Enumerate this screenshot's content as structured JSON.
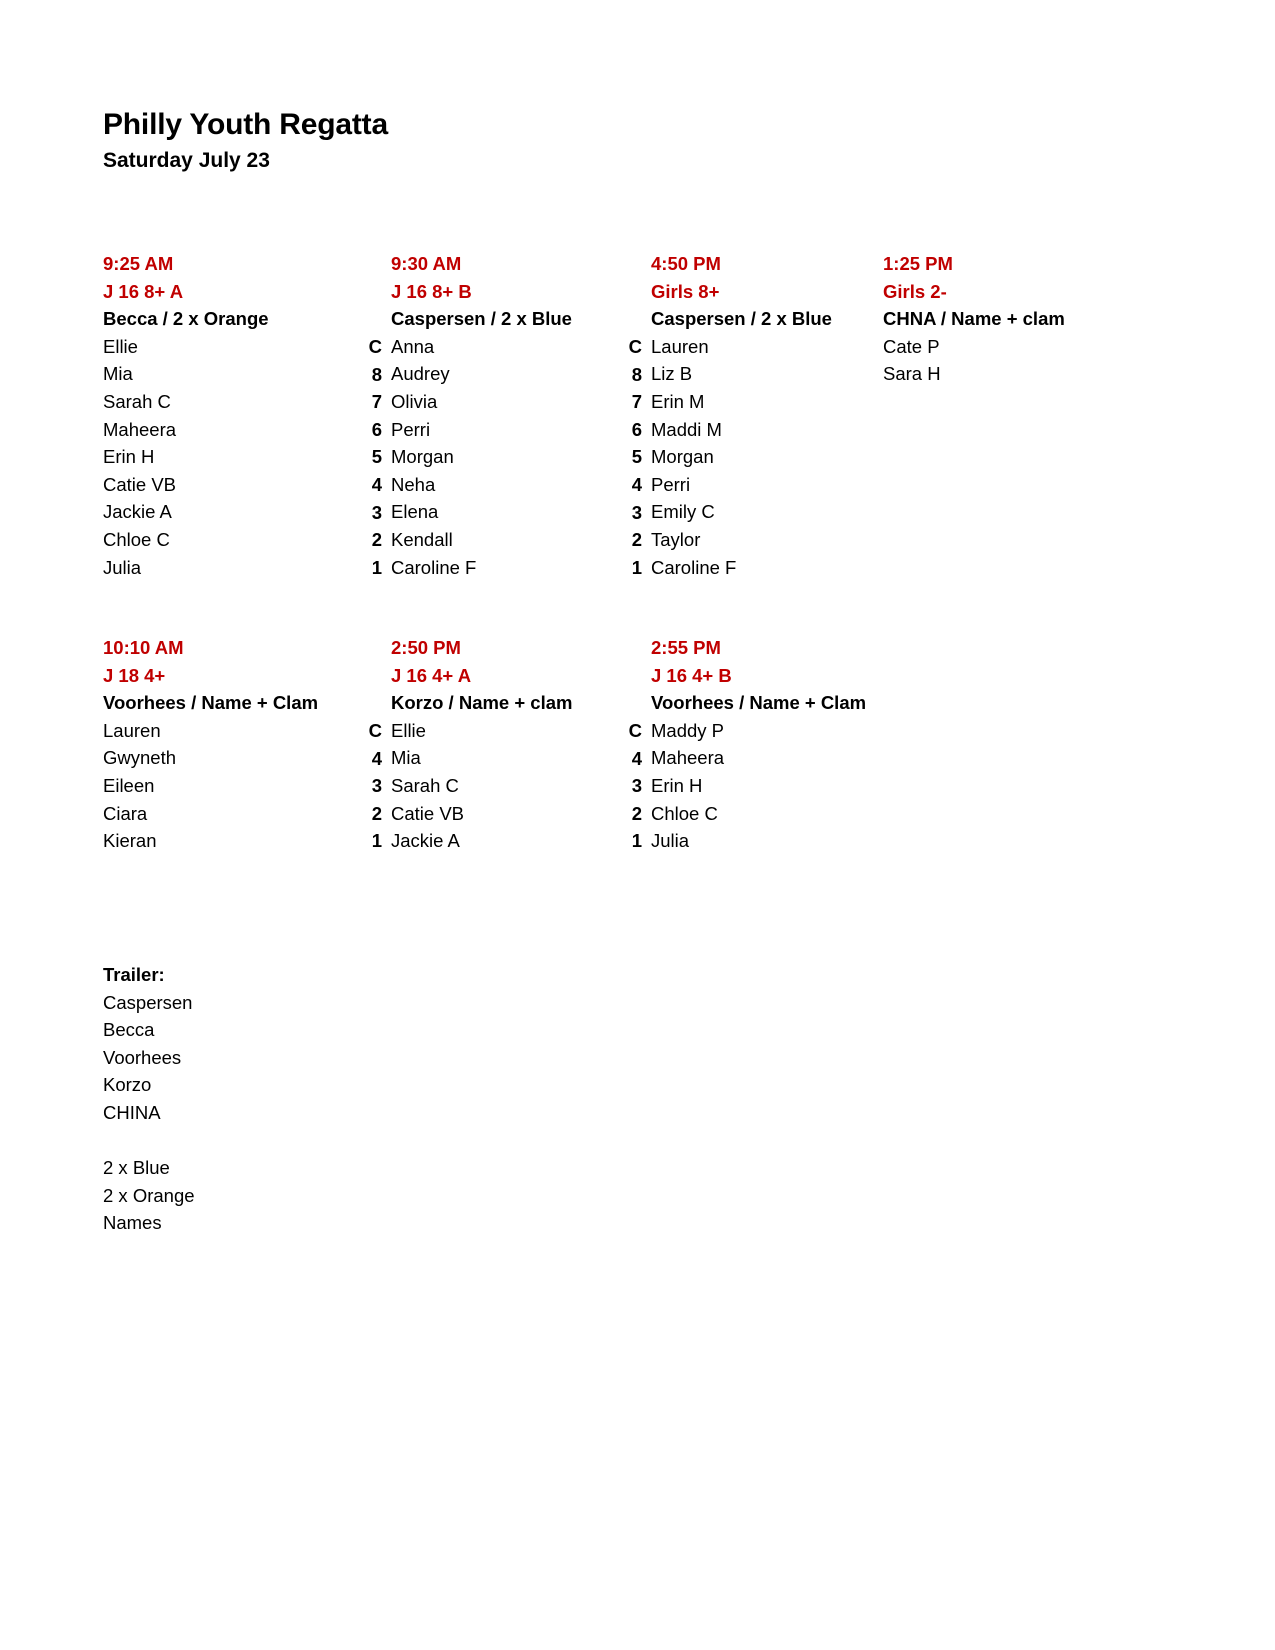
{
  "header": {
    "title": "Philly Youth Regatta",
    "subtitle": "Saturday July 23"
  },
  "colors": {
    "heading_red": "#C00000",
    "body_black": "#000000",
    "page_background": "#FFFFFF"
  },
  "sections": [
    {
      "id": "section-1",
      "columns": [
        {
          "time": "9:25 AM",
          "event": "J 16 8+ A",
          "boat": "Becca / 2 x Orange",
          "has_seat_gutter": false,
          "seats": [],
          "rowers": [
            "Ellie",
            "Mia",
            "Sarah C",
            "Maheera",
            "Erin H",
            "Catie VB",
            "Jackie A",
            "Chloe C",
            "Julia"
          ]
        },
        {
          "time": "9:30 AM",
          "event": "J 16 8+ B",
          "boat": "Caspersen / 2 x Blue",
          "has_seat_gutter": true,
          "seats": [
            "C",
            "8",
            "7",
            "6",
            "5",
            "4",
            "3",
            "2",
            "1"
          ],
          "rowers": [
            "Anna",
            "Audrey",
            "Olivia",
            "Perri",
            "Morgan",
            "Neha",
            "Elena",
            "Kendall",
            "Caroline F"
          ]
        },
        {
          "time": "4:50 PM",
          "event": "Girls 8+",
          "boat": "Caspersen / 2 x Blue",
          "has_seat_gutter": true,
          "seats": [
            "C",
            "8",
            "7",
            "6",
            "5",
            "4",
            "3",
            "2",
            "1"
          ],
          "rowers": [
            "Lauren",
            "Liz B",
            "Erin M",
            "Maddi M",
            "Morgan",
            "Perri",
            "Emily C",
            "Taylor",
            "Caroline F"
          ]
        },
        {
          "time": "1:25 PM",
          "event": "Girls 2-",
          "boat": "CHNA / Name + clam",
          "has_seat_gutter": false,
          "seats": [],
          "rowers": [
            "Cate P",
            "Sara H"
          ]
        }
      ]
    },
    {
      "id": "section-2",
      "columns": [
        {
          "time": "10:10 AM",
          "event": "J 18 4+",
          "boat": "Voorhees / Name + Clam",
          "has_seat_gutter": false,
          "seats": [],
          "rowers": [
            "Lauren",
            "Gwyneth",
            "Eileen",
            "Ciara",
            "Kieran"
          ]
        },
        {
          "time": "2:50 PM",
          "event": "J 16 4+ A",
          "boat": "Korzo / Name + clam",
          "has_seat_gutter": true,
          "seats": [
            "C",
            "4",
            "3",
            "2",
            "1"
          ],
          "rowers": [
            "Ellie",
            "Mia",
            "Sarah C",
            "Catie VB",
            "Jackie A"
          ]
        },
        {
          "time": "2:55 PM",
          "event": "J 16 4+ B",
          "boat": "Voorhees / Name + Clam",
          "has_seat_gutter": true,
          "seats": [
            "C",
            "4",
            "3",
            "2",
            "1"
          ],
          "rowers": [
            "Maddy P",
            "Maheera",
            "Erin H",
            "Chloe C",
            "Julia"
          ]
        }
      ]
    }
  ],
  "trailer": {
    "heading": "Trailer:",
    "boats": [
      "Caspersen",
      "Becca",
      "Voorhees",
      "Korzo",
      "CHINA"
    ],
    "equipment": [
      "2 x Blue",
      "2 x Orange",
      "Names"
    ]
  }
}
